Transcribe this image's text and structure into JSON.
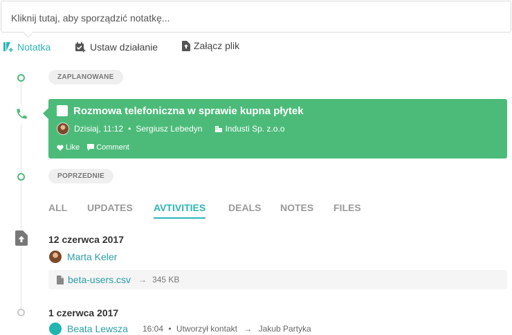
{
  "composer": {
    "placeholder": "Kliknij tutaj, aby sporządzić notatkę..."
  },
  "action_tabs": [
    {
      "label": "Notatka",
      "icon": "note-add-icon",
      "active": true
    },
    {
      "label": "Ustaw działanie",
      "icon": "calendar-check-icon",
      "active": false
    },
    {
      "label": "Załącz plik",
      "icon": "file-upload-icon",
      "active": false
    }
  ],
  "sections": {
    "planned": "ZAPLANOWANE",
    "previous": "POPRZEDNIE"
  },
  "planned_call": {
    "icon": "phone-icon",
    "title": "Rozmowa telefoniczna w sprawie kupna płytek",
    "time": "Dzisiaj, 11:12",
    "bullet": "•",
    "owner": "Sergiusz Lebedyn",
    "company": "Industi Sp. z.o.o",
    "like_label": "Like",
    "comment_label": "Comment",
    "color": "#4cbb7a"
  },
  "filter_tabs": [
    {
      "label": "ALL",
      "active": false
    },
    {
      "label": "UPDATES",
      "active": false
    },
    {
      "label": "AVTIVITIES",
      "active": true
    },
    {
      "label": "DEALS",
      "active": false
    },
    {
      "label": "NOTES",
      "active": false
    },
    {
      "label": "FILES",
      "active": false
    }
  ],
  "entries": [
    {
      "date": "12 czerwca 2017",
      "person": "Marta Keler",
      "file_name": "beta-users.csv",
      "arrow": "→",
      "file_size": "345 KB"
    },
    {
      "date": "1 czerwca 2017",
      "person": "Beata Lewsza",
      "time": "16:04",
      "bullet": "•",
      "action": "Utworzył kontakt",
      "arrow": "→",
      "target": "Jakub Partyka"
    }
  ],
  "colors": {
    "accent": "#2bb5b5",
    "success": "#4cbb7a",
    "link": "#2a9fa6"
  }
}
